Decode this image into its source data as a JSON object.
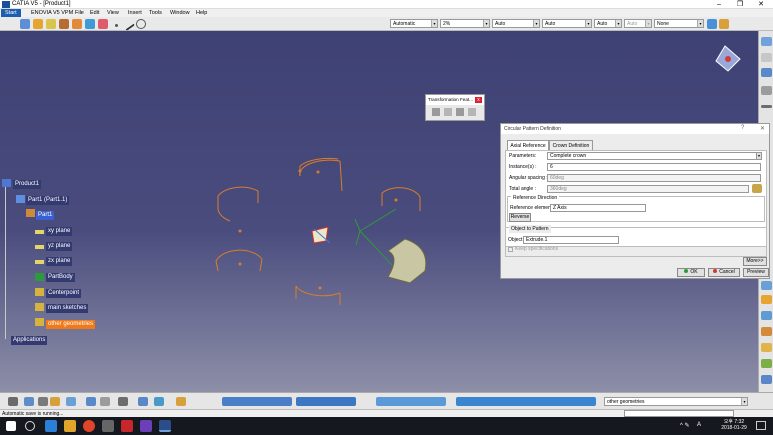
{
  "window": {
    "title": "CATIA V5 - [Product1]",
    "min": "–",
    "max": "❐",
    "close": "✕"
  },
  "menu": [
    "Start",
    "ENOVIA V5 VPM",
    "File",
    "Edit",
    "View",
    "Insert",
    "Tools",
    "Window",
    "Help"
  ],
  "toolbar": {
    "combo1": "Automatic",
    "combo2": "2%",
    "combo3": "Auto",
    "combo4": "Auto",
    "combo5": "Auto",
    "combo6": "Auto",
    "combo7": "None"
  },
  "tree": {
    "root": "Product1",
    "part": "Part1 (Part1.1)",
    "part_sub": "Part1",
    "items": [
      "xy plane",
      "yz plane",
      "zx plane",
      "PartBody",
      "Centerpoint",
      "main sketches",
      "other geometries"
    ],
    "applications": "Applications"
  },
  "transform_dialog": {
    "title": "Transformation Feat...",
    "close": "x"
  },
  "pattern_dialog": {
    "title": "Circular Pattern Definition",
    "help": "?",
    "close": "✕",
    "tabs": [
      "Axial Reference",
      "Crown Definition"
    ],
    "parameters_label": "Parameters:",
    "parameters_value": "Complete crown",
    "instances_label": "Instance(s) :",
    "instances_value": "6",
    "angular_label": "Angular spacing :",
    "angular_value": "60deg",
    "total_label": "Total angle :",
    "total_value": "360deg",
    "ref_direction": "Reference Direction",
    "ref_element_label": "Reference element:",
    "ref_element_value": "Z Axis",
    "reverse": "Reverse",
    "object_group": "Object to Pattern",
    "object_label": "Object:",
    "object_value": "Extrude.1",
    "keep_spec": "Keep specifications",
    "more": "More>>",
    "ok": "OK",
    "cancel": "Cancel",
    "preview": "Preview"
  },
  "bottom": {
    "geometry_combo": "other geometries"
  },
  "status": {
    "text": "Automatic save is running..."
  },
  "taskbar": {
    "time": "오후 7:32",
    "date": "2018-01-29",
    "lang": "A"
  },
  "colors": {
    "viewport_top": "#3e4173",
    "selection": "#3a5fd0",
    "highlight": "#f07a1a",
    "accent": "#1c5fb0",
    "orange_geom": "#d87d2a"
  }
}
